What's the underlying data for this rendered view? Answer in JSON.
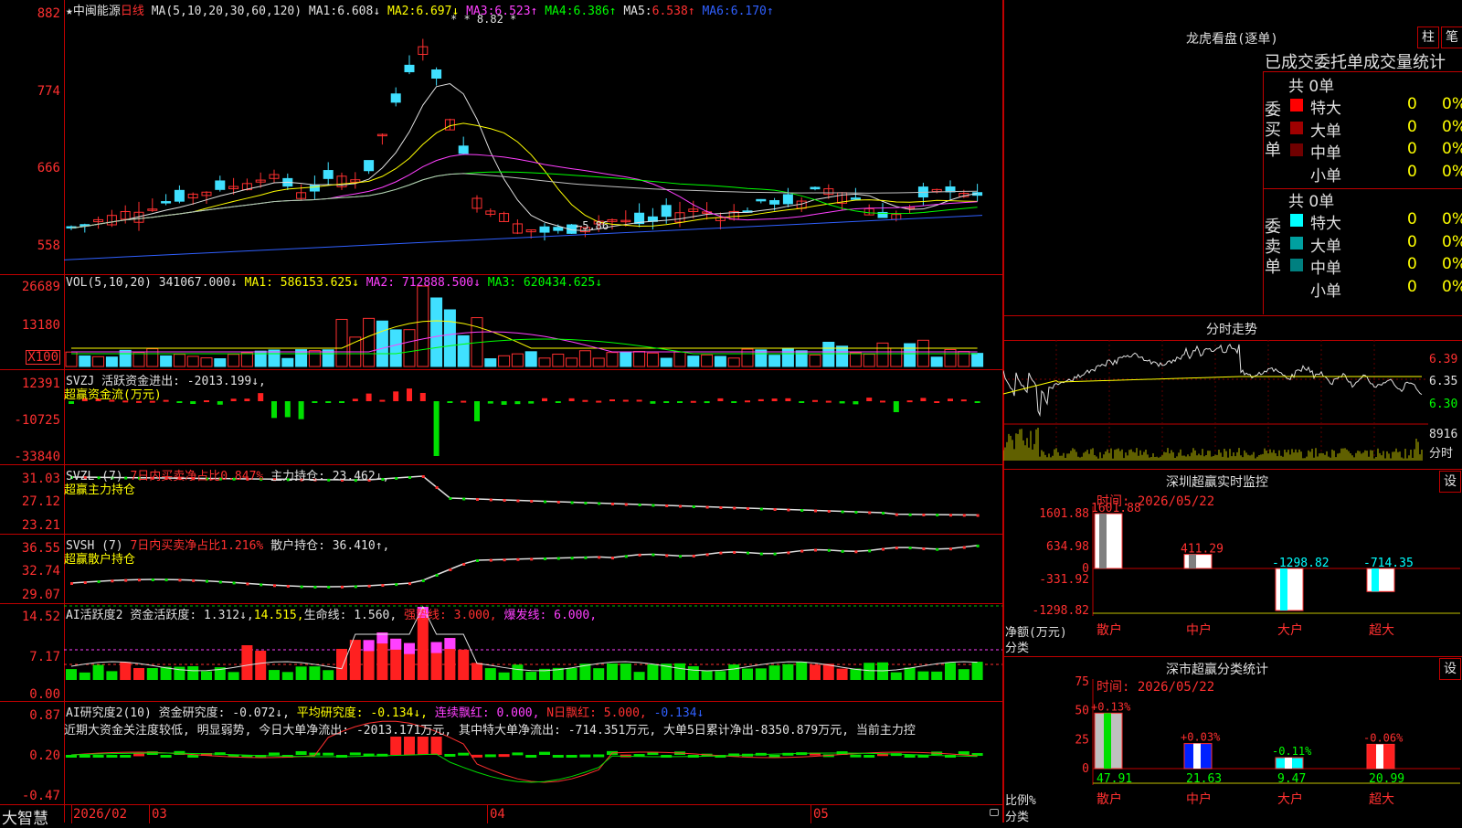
{
  "stock": {
    "star": "★",
    "name": "中闽能源",
    "period": "日线"
  },
  "main": {
    "ma_def": "MA(5,10,20,30,60,120)",
    "ma": [
      {
        "label": "MA1:",
        "value": "6.608↓",
        "color": "#e0e0e0"
      },
      {
        "label": "MA2:",
        "value": "6.697↓",
        "color": "#ffff00"
      },
      {
        "label": "MA3:",
        "value": "6.523↑",
        "color": "#ff40ff"
      },
      {
        "label": "MA4:",
        "value": "6.386↑",
        "color": "#00ff00"
      },
      {
        "label": "MA5:",
        "value": "6.538↑",
        "color": "#e0e0e0"
      },
      {
        "label": "MA6:",
        "value": "6.170↑",
        "color": "#3060ff"
      }
    ],
    "yticks": [
      "882",
      "774",
      "666",
      "558"
    ],
    "high_marker": "8.82",
    "low_marker": "5.86",
    "stars": "*  *"
  },
  "vol": {
    "name": "VOL(5,10,20)",
    "v": "341067.000↓",
    "ma1": "MA1: 586153.625↓",
    "ma2": "MA2: 712888.500↓",
    "ma3": "MA3: 620434.625↓",
    "yticks": [
      "26689",
      "13180"
    ],
    "unit": "X100"
  },
  "svzj": {
    "name": "SVZJ",
    "label": "活跃资金进出: -2013.199↓,",
    "sub": "超赢资金流(万元)",
    "yticks": [
      "12391",
      "-10725",
      "-33840"
    ]
  },
  "svzl": {
    "name": "SVZL (7)",
    "net": "7日内买卖净占比0.847%",
    "hold": "主力持仓: 23.462↓,",
    "sub": "超赢主力持仓",
    "yticks": [
      "31.03",
      "27.12",
      "23.21"
    ]
  },
  "svsh": {
    "name": "SVSH (7)",
    "net": "7日内买卖净占比1.216%",
    "hold": "散户持仓: 36.410↑,",
    "sub": "超赢散户持仓",
    "yticks": [
      "36.55",
      "32.74",
      "29.07"
    ]
  },
  "ai1": {
    "name": "AI活跃度2",
    "a": "资金活跃度: 1.312↓,",
    "b": "14.515,",
    "c": "生命线: 1.560,",
    "d": "强势线: 3.000,",
    "e": "爆发线: 6.000,",
    "yticks": [
      "14.52",
      "7.17",
      "0.00"
    ]
  },
  "ai2": {
    "name": "AI研究度2(10)",
    "a": "资金研究度: -0.072↓,",
    "b": "平均研究度: -0.134↓,",
    "c": "连续飘红: 0.000,",
    "d": "N日飘红: 5.000,",
    "e": "-0.134↓",
    "text": "近期大资金关注度较低, 明显弱势, 今日大单净流出: -2013.171万元, 其中特大单净流出: -714.351万元, 大单5日累计净出-8350.879万元, 当前主力控",
    "yticks": [
      "0.87",
      "0.20",
      "-0.47"
    ]
  },
  "bottom": {
    "brand": "大智慧",
    "dates": [
      "2026/02",
      "03",
      "04",
      "05"
    ]
  },
  "lhb": {
    "title": "龙虎看盘(逐单)",
    "btn1": "柱",
    "btn2": "笔",
    "subtitle": "已成交委托单成交量统计",
    "buy_label": "委买单",
    "sell_label": "委卖单",
    "buy_total": "共 0单",
    "sell_total": "共 0单",
    "buy_rows": [
      {
        "name": "特大",
        "count": "0",
        "pct": "0%",
        "color": "#ff0000"
      },
      {
        "name": "大单",
        "count": "0",
        "pct": "0%",
        "color": "#a00000"
      },
      {
        "name": "中单",
        "count": "0",
        "pct": "0%",
        "color": "#700000"
      },
      {
        "name": "小单",
        "count": "0",
        "pct": "0%",
        "color": "#000000"
      }
    ],
    "sell_rows": [
      {
        "name": "特大",
        "count": "0",
        "pct": "0%",
        "color": "#00ffff"
      },
      {
        "name": "大单",
        "count": "0",
        "pct": "0%",
        "color": "#00a0a0"
      },
      {
        "name": "中单",
        "count": "0",
        "pct": "0%",
        "color": "#008080"
      },
      {
        "name": "小单",
        "count": "0",
        "pct": "0%",
        "color": "#000000"
      }
    ]
  },
  "intraday": {
    "title": "分时走势",
    "prices": [
      "6.39",
      "6.35",
      "6.30"
    ],
    "vol": "8916",
    "vol_label": "分时"
  },
  "sz_monitor": {
    "title": "深圳超赢实时监控",
    "btn": "设",
    "time": "时间: 2026/05/22",
    "yticks": [
      "1601.88",
      "634.98",
      "0",
      "-331.92",
      "-1298.82"
    ],
    "ylabel": "净额(万元)",
    "xlabel": "分类",
    "categories": [
      "散户",
      "中户",
      "大户",
      "超大"
    ],
    "values": [
      "1601.88",
      "411.29",
      "-1298.82",
      "-714.35"
    ]
  },
  "sz_class": {
    "title": "深市超赢分类统计",
    "btn": "设",
    "time": "时间: 2026/05/22",
    "yticks": [
      "75",
      "50",
      "25",
      "0"
    ],
    "ylabel": "比例%",
    "xlabel": "分类",
    "categories": [
      "散户",
      "中户",
      "大户",
      "超大"
    ],
    "changes": [
      "+0.13%",
      "+0.03%",
      "-0.11%",
      "-0.06%"
    ],
    "values": [
      "47.91",
      "21.63",
      "9.47",
      "20.99"
    ]
  }
}
